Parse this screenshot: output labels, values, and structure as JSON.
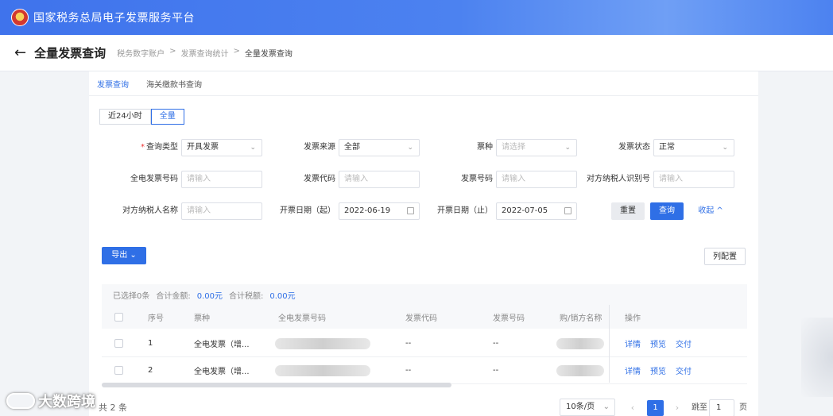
{
  "app": {
    "title": "国家税务总局电子发票服务平台"
  },
  "header": {
    "page_title": "全量发票查询",
    "breadcrumb": [
      "税务数字账户",
      "发票查询统计",
      "全量发票查询"
    ],
    "separator": ">"
  },
  "tabs": [
    {
      "label": "发票查询",
      "active": true
    },
    {
      "label": "海关缴款书查询",
      "active": false
    }
  ],
  "range_toggle": [
    {
      "label": "近24小时",
      "active": false
    },
    {
      "label": "全量",
      "active": true
    }
  ],
  "form": {
    "query_type": {
      "label": "查询类型",
      "required_mark": "*",
      "value": "开具发票"
    },
    "invoice_source": {
      "label": "发票来源",
      "value": "全部"
    },
    "ticket_type": {
      "label": "票种",
      "placeholder": "请选择"
    },
    "invoice_status": {
      "label": "发票状态",
      "value": "正常"
    },
    "full_invoice_no": {
      "label": "全电发票号码",
      "placeholder": "请输入"
    },
    "invoice_code": {
      "label": "发票代码",
      "placeholder": "请输入"
    },
    "invoice_no": {
      "label": "发票号码",
      "placeholder": "请输入"
    },
    "counterparty_id": {
      "label": "对方纳税人识别号",
      "placeholder": "请输入"
    },
    "counterparty_name": {
      "label": "对方纳税人名称",
      "placeholder": "请输入"
    },
    "date_start": {
      "label": "开票日期（起）",
      "value": "2022-06-19"
    },
    "date_end": {
      "label": "开票日期（止）",
      "value": "2022-07-05"
    },
    "reset_label": "重置",
    "search_label": "查询",
    "collapse_label": "收起 ^"
  },
  "toolbar": {
    "export_label": "导出 ⌄",
    "columns_label": "列配置"
  },
  "summary": {
    "selected": "已选择0条",
    "total_amount_label": "合计金额:",
    "total_amount": "0.00元",
    "total_tax_label": "合计税额:",
    "total_tax": "0.00元"
  },
  "table": {
    "headers": [
      "序号",
      "票种",
      "全电发票号码",
      "发票代码",
      "发票号码",
      "购/销方名称",
      "操作"
    ],
    "rows": [
      {
        "index": "1",
        "type": "全电发票（增...",
        "code": "--",
        "number": "--"
      },
      {
        "index": "2",
        "type": "全电发票（增...",
        "code": "--",
        "number": "--"
      }
    ],
    "actions": [
      "详情",
      "预览",
      "交付"
    ]
  },
  "pagination": {
    "total": "共 2 条",
    "page_size": "10条/页",
    "current_page": "1",
    "goto_label": "跳至",
    "goto_value": "1",
    "page_suffix": "页"
  },
  "watermark": {
    "text": "大数跨境"
  },
  "colors": {
    "primary": "#2f6fe6",
    "topbar": "#4c82f0"
  }
}
